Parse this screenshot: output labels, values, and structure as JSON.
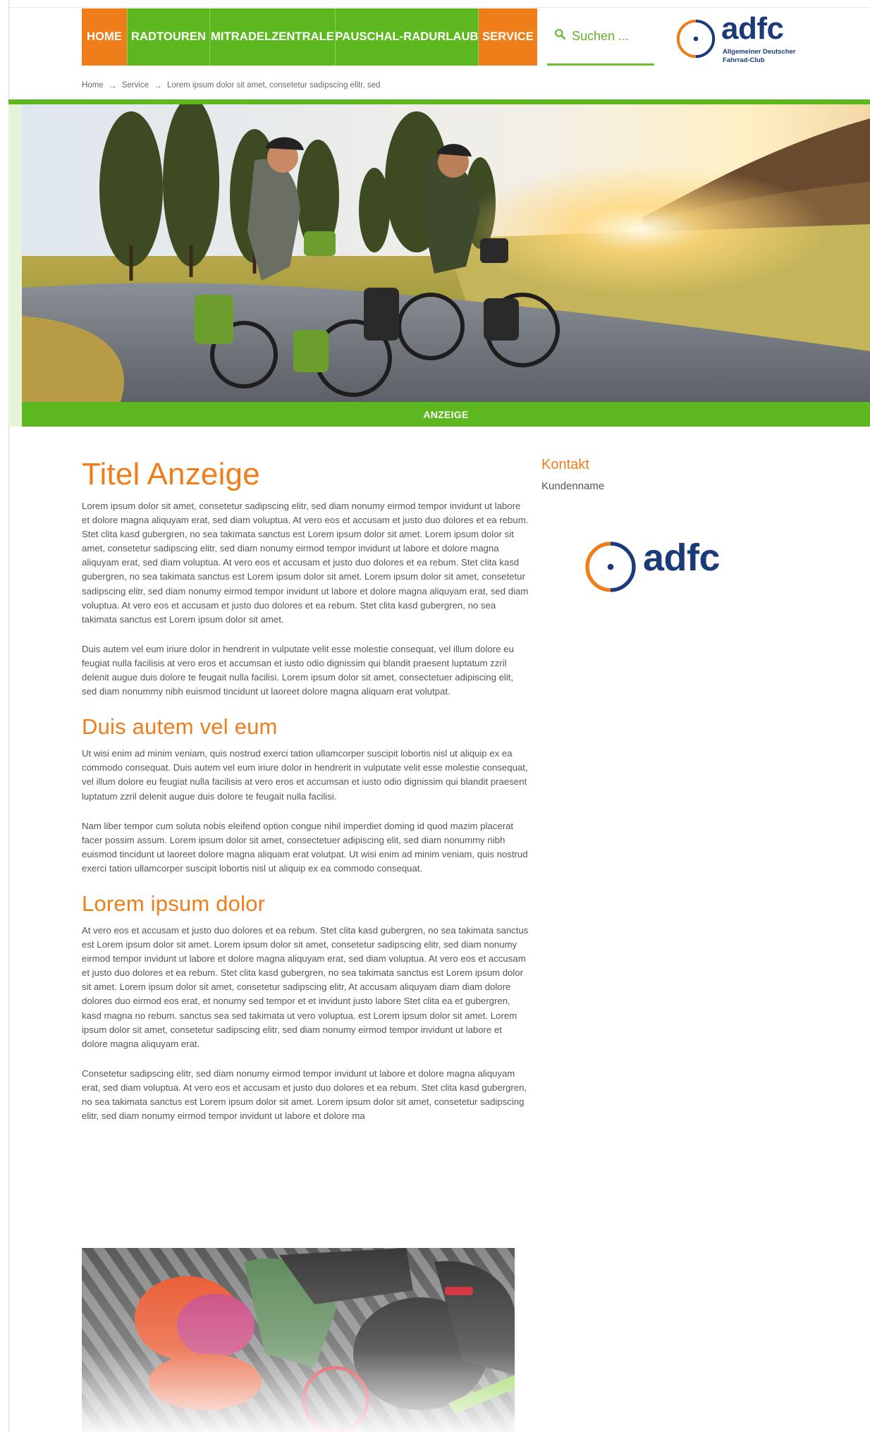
{
  "nav": {
    "items": [
      {
        "label": "HOME",
        "color": "orange"
      },
      {
        "label": "RADTOUREN",
        "color": "green"
      },
      {
        "label": "MITRADELZENTRALE",
        "color": "green"
      },
      {
        "label": "PAUSCHAL-RADURLAUB",
        "color": "green"
      },
      {
        "label": "SERVICE",
        "color": "orange"
      }
    ],
    "search_placeholder": "Suchen ..."
  },
  "logo": {
    "word": "adfc",
    "subtitle_line1": "Allgemeiner Deutscher",
    "subtitle_line2": "Fahrrad-Club"
  },
  "breadcrumb": [
    "Home",
    "Service",
    "Lorem ipsum dolor sit amet, consetetur sadipscing elitr, sed"
  ],
  "hero": {
    "caption": "ANZEIGE"
  },
  "main": {
    "title": "Titel Anzeige",
    "intro_paragraphs": [
      "Lorem ipsum dolor sit amet, consetetur sadipscing elitr, sed diam nonumy eirmod tempor invidunt ut labore et dolore magna aliquyam erat, sed diam voluptua. At vero eos et accusam et justo duo dolores et ea rebum. Stet clita kasd gubergren, no sea takimata sanctus est Lorem ipsum dolor sit amet. Lorem ipsum dolor sit amet, consetetur sadipscing elitr, sed diam nonumy eirmod tempor invidunt ut labore et dolore magna aliquyam erat, sed diam voluptua. At vero eos et accusam et justo duo dolores et ea rebum. Stet clita kasd gubergren, no sea takimata sanctus est Lorem ipsum dolor sit amet. Lorem ipsum dolor sit amet, consetetur sadipscing elitr, sed diam nonumy eirmod tempor invidunt ut labore et dolore magna aliquyam erat, sed diam voluptua. At vero eos et accusam et justo duo dolores et ea rebum. Stet clita kasd gubergren, no sea takimata sanctus est Lorem ipsum dolor sit amet.",
      "Duis autem vel eum iriure dolor in hendrerit in vulputate velit esse molestie consequat, vel illum dolore eu feugiat nulla facilisis at vero eros et accumsan et iusto odio dignissim qui blandit praesent luptatum zzril delenit augue duis dolore te feugait nulla facilisi. Lorem ipsum dolor sit amet, consectetuer adipiscing elit, sed diam nonummy nibh euismod tincidunt ut laoreet dolore magna aliquam erat volutpat."
    ],
    "section1_title": "Duis autem vel eum",
    "section1_paragraphs": [
      "Ut wisi enim ad minim veniam, quis nostrud exerci tation ullamcorper suscipit lobortis nisl ut aliquip ex ea commodo consequat. Duis autem vel eum iriure dolor in hendrerit in vulputate velit esse molestie consequat, vel illum dolore eu feugiat nulla facilisis at vero eros et accumsan et iusto odio dignissim qui blandit praesent luptatum zzril delenit augue duis dolore te feugait nulla facilisi.",
      "Nam liber tempor cum soluta nobis eleifend option congue nihil imperdiet doming id quod mazim placerat facer possim assum. Lorem ipsum dolor sit amet, consectetuer adipiscing elit, sed diam nonummy nibh euismod tincidunt ut laoreet dolore magna aliquam erat volutpat. Ut wisi enim ad minim veniam, quis nostrud exerci tation ullamcorper suscipit lobortis nisl ut aliquip ex ea commodo consequat."
    ],
    "section2_title": "Lorem ipsum dolor",
    "section2_paragraphs": [
      "At vero eos et accusam et justo duo dolores et ea rebum. Stet clita kasd gubergren, no sea takimata sanctus est Lorem ipsum dolor sit amet. Lorem ipsum dolor sit amet, consetetur sadipscing elitr, sed diam nonumy eirmod tempor invidunt ut labore et dolore magna aliquyam erat, sed diam voluptua. At vero eos et accusam et justo duo dolores et ea rebum. Stet clita kasd gubergren, no sea takimata sanctus est Lorem ipsum dolor sit amet. Lorem ipsum dolor sit amet, consetetur sadipscing elitr, At accusam aliquyam diam diam dolore dolores duo eirmod eos erat, et nonumy sed tempor et et invidunt justo labore Stet clita ea et gubergren, kasd magna no rebum. sanctus sea sed takimata ut vero voluptua. est Lorem ipsum dolor sit amet. Lorem ipsum dolor sit amet, consetetur sadipscing elitr, sed diam nonumy eirmod tempor invidunt ut labore et dolore magna aliquyam erat.",
      "Consetetur sadipscing elitr, sed diam nonumy eirmod tempor invidunt ut labore et dolore magna aliquyam erat, sed diam voluptua. At vero eos et accusam et justo duo dolores et ea rebum. Stet clita kasd gubergren, no sea takimata sanctus est Lorem ipsum dolor sit amet. Lorem ipsum dolor sit amet, consetetur sadipscing elitr, sed diam nonumy eirmod tempor invidunt ut labore et dolore ma"
    ]
  },
  "sidebar": {
    "title": "Kontakt",
    "customer_name": "Kundenname",
    "logo_word": "adfc"
  },
  "colors": {
    "orange": "#ee7d1a",
    "green": "#5cb81e",
    "navy": "#1b3a7a"
  }
}
